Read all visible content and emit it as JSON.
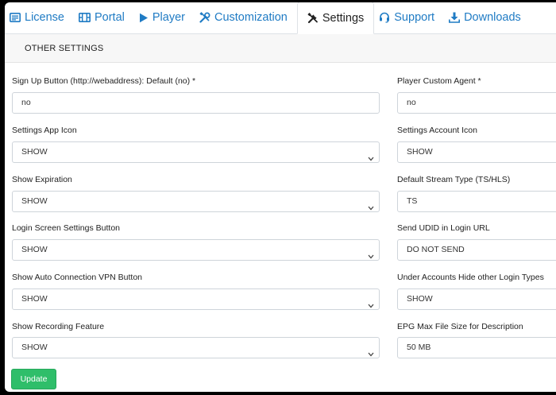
{
  "tabs": [
    {
      "label": "License",
      "icon": "id-card-icon"
    },
    {
      "label": "Portal",
      "icon": "film-icon"
    },
    {
      "label": "Player",
      "icon": "play-icon"
    },
    {
      "label": "Customization",
      "icon": "tools-icon"
    },
    {
      "label": "Settings",
      "icon": "wrench-icon",
      "active": true
    },
    {
      "label": "Support",
      "icon": "headset-icon"
    },
    {
      "label": "Downloads",
      "icon": "download-icon"
    }
  ],
  "section_title": "OTHER SETTINGS",
  "left_fields": [
    {
      "label": "Sign Up Button (http://webaddress): Default (no) *",
      "value": "no",
      "kind": "input"
    },
    {
      "label": "Settings App Icon",
      "value": "SHOW",
      "kind": "select"
    },
    {
      "label": "Show Expiration",
      "value": "SHOW",
      "kind": "select"
    },
    {
      "label": "Login Screen Settings Button",
      "value": "SHOW",
      "kind": "select"
    },
    {
      "label": "Show Auto Connection VPN Button",
      "value": "SHOW",
      "kind": "select"
    },
    {
      "label": "Show Recording Feature",
      "value": "SHOW",
      "kind": "select"
    }
  ],
  "right_fields": [
    {
      "label": "Player Custom Agent *",
      "value": "no",
      "kind": "input"
    },
    {
      "label": "Settings Account Icon",
      "value": "SHOW",
      "kind": "select"
    },
    {
      "label": "Default Stream Type (TS/HLS)",
      "value": "TS",
      "kind": "select"
    },
    {
      "label": "Send UDID in Login URL",
      "value": "DO NOT SEND",
      "kind": "select"
    },
    {
      "label": "Under Accounts Hide other Login Types",
      "value": "SHOW",
      "kind": "select"
    },
    {
      "label": "EPG Max File Size for Description",
      "value": "50 MB",
      "kind": "select"
    }
  ],
  "update_label": "Update",
  "colors": {
    "accent": "#1f7bc4",
    "button": "#2fbe6a"
  }
}
